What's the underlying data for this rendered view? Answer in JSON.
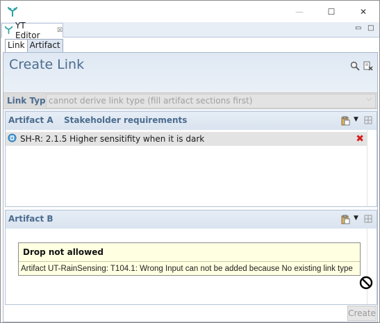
{
  "window": {
    "controls": {
      "minimize": "—",
      "maximize": "☐",
      "close": "✕"
    }
  },
  "editor_tab": {
    "label": "YT Editor",
    "close_glyph": "☒"
  },
  "view_controls": {
    "minimize": "▭",
    "maximize": "□"
  },
  "inner_tabs": [
    {
      "label": "Link",
      "active": true
    },
    {
      "label": "Artifact",
      "active": false
    }
  ],
  "form": {
    "title": "Create Link",
    "link_type_label": "Link Type",
    "link_type_placeholder": "cannot derive link type (fill artifact sections first)"
  },
  "artifact_a": {
    "title": "Artifact A",
    "subtitle": "Stakeholder requirements",
    "items": [
      {
        "text": "SH-R: 2.1.5 Higher sensitifity when it is dark"
      }
    ]
  },
  "artifact_b": {
    "title": "Artifact B"
  },
  "tooltip": {
    "title": "Drop not allowed",
    "message": "Artifact UT-RainSensing: T104.1: Wrong Input can not be added because No existing link type"
  },
  "buttons": {
    "create": "Create"
  },
  "icons": {
    "app": "yt-logo-icon",
    "search": "search-icon",
    "clear": "clear-document-icon",
    "paste": "paste-icon",
    "dropdown": "dropdown-arrow-icon",
    "expand": "expand-icon",
    "remove": "remove-icon",
    "requirement": "requirement-icon",
    "no_drop": "no-drop-cursor-icon"
  },
  "colors": {
    "accent": "#4b6c8e",
    "remove": "#d32020",
    "tooltip_bg": "#ffffe1",
    "logo": "#2aa1a1"
  }
}
